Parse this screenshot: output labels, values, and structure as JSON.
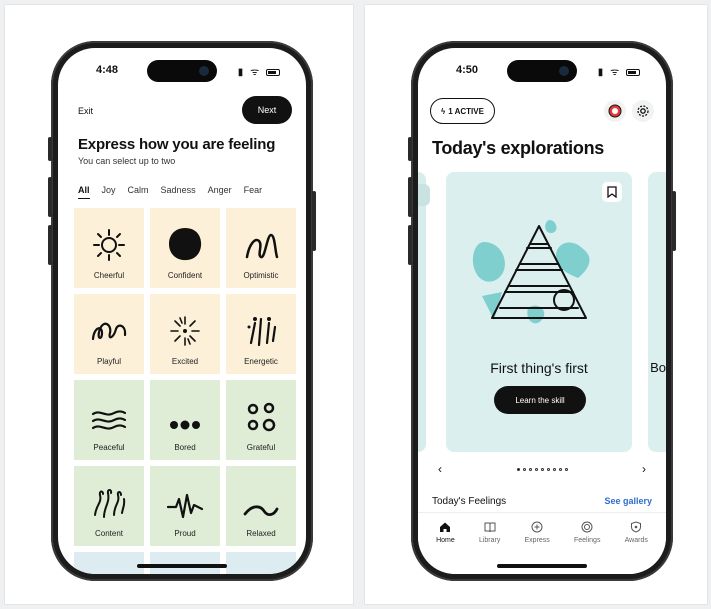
{
  "left_phone": {
    "status": {
      "time": "4:48"
    },
    "header": {
      "exit_label": "Exit",
      "next_label": "Next"
    },
    "title": "Express how you are feeling",
    "subtitle": "You can select up to two",
    "filters": [
      "All",
      "Joy",
      "Calm",
      "Sadness",
      "Anger",
      "Fear"
    ],
    "active_filter": "All",
    "feelings": [
      {
        "label": "Cheerful",
        "icon": "sunburst-icon",
        "color": "#fdf0d8"
      },
      {
        "label": "Confident",
        "icon": "blob-icon",
        "color": "#fdf0d8"
      },
      {
        "label": "Optimistic",
        "icon": "swirl-icon",
        "color": "#fdf0d8"
      },
      {
        "label": "Playful",
        "icon": "loops-icon",
        "color": "#fdf0d8"
      },
      {
        "label": "Excited",
        "icon": "burst-icon",
        "color": "#fdf0d8"
      },
      {
        "label": "Energetic",
        "icon": "sparks-icon",
        "color": "#fdf0d8"
      },
      {
        "label": "Peaceful",
        "icon": "waves-icon",
        "color": "#dfedd7"
      },
      {
        "label": "Bored",
        "icon": "dots-icon",
        "color": "#dfedd7"
      },
      {
        "label": "Grateful",
        "icon": "circles-icon",
        "color": "#dfedd7"
      },
      {
        "label": "Content",
        "icon": "tendrils-icon",
        "color": "#dfedd7"
      },
      {
        "label": "Proud",
        "icon": "heartbeat-icon",
        "color": "#dfedd7"
      },
      {
        "label": "Relaxed",
        "icon": "tilde-icon",
        "color": "#dfedd7"
      }
    ]
  },
  "right_phone": {
    "status": {
      "time": "4:50"
    },
    "active_pill": "1 ACTIVE",
    "title": "Today's explorations",
    "card": {
      "title": "First thing's first",
      "button": "Learn the skill",
      "peek_text": "Bo"
    },
    "pager": {
      "prev": "‹",
      "next": "›",
      "count": 9,
      "current": 0
    },
    "feelings_label": "Today's Feelings",
    "gallery_link": "See gallery",
    "tabs": [
      {
        "label": "Home",
        "icon": "home-icon",
        "active": true
      },
      {
        "label": "Library",
        "icon": "book-icon",
        "active": false
      },
      {
        "label": "Express",
        "icon": "plus-circle-icon",
        "active": false
      },
      {
        "label": "Feelings",
        "icon": "spiral-icon",
        "active": false
      },
      {
        "label": "Awards",
        "icon": "shield-icon",
        "active": false
      }
    ],
    "accent_color": "#2e6fd1",
    "card_color": "#dcefef"
  }
}
